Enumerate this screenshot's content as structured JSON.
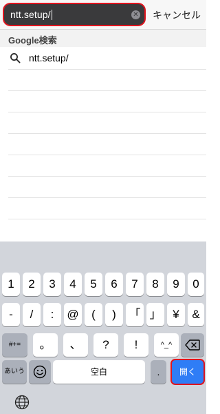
{
  "search": {
    "value": "ntt.setup/",
    "clear_icon": "clear-circle-icon",
    "cancel_label": "キャンセル"
  },
  "results": {
    "section_title": "Google検索",
    "suggestion": "ntt.setup/",
    "suggestion_icon": "search-icon"
  },
  "keyboard": {
    "row1": [
      "1",
      "2",
      "3",
      "4",
      "5",
      "6",
      "7",
      "8",
      "9",
      "0"
    ],
    "row2": [
      "-",
      "/",
      ":",
      "@",
      "(",
      ")",
      "「",
      "」",
      "¥",
      "&"
    ],
    "row3_left": "#+=",
    "row3": [
      "。",
      "、",
      "?",
      "!",
      "^_^"
    ],
    "row3_right_icon": "backspace-icon",
    "row4": {
      "kana": "あいう",
      "emoji_icon": "emoji-icon",
      "space": "空白",
      "period": ".",
      "go": "開く"
    },
    "globe_icon": "globe-icon"
  },
  "colors": {
    "highlight": "#e0141e",
    "go_key": "#2f7df6",
    "keyboard_bg": "#d2d5db",
    "field_bg": "#3a3a3c"
  }
}
